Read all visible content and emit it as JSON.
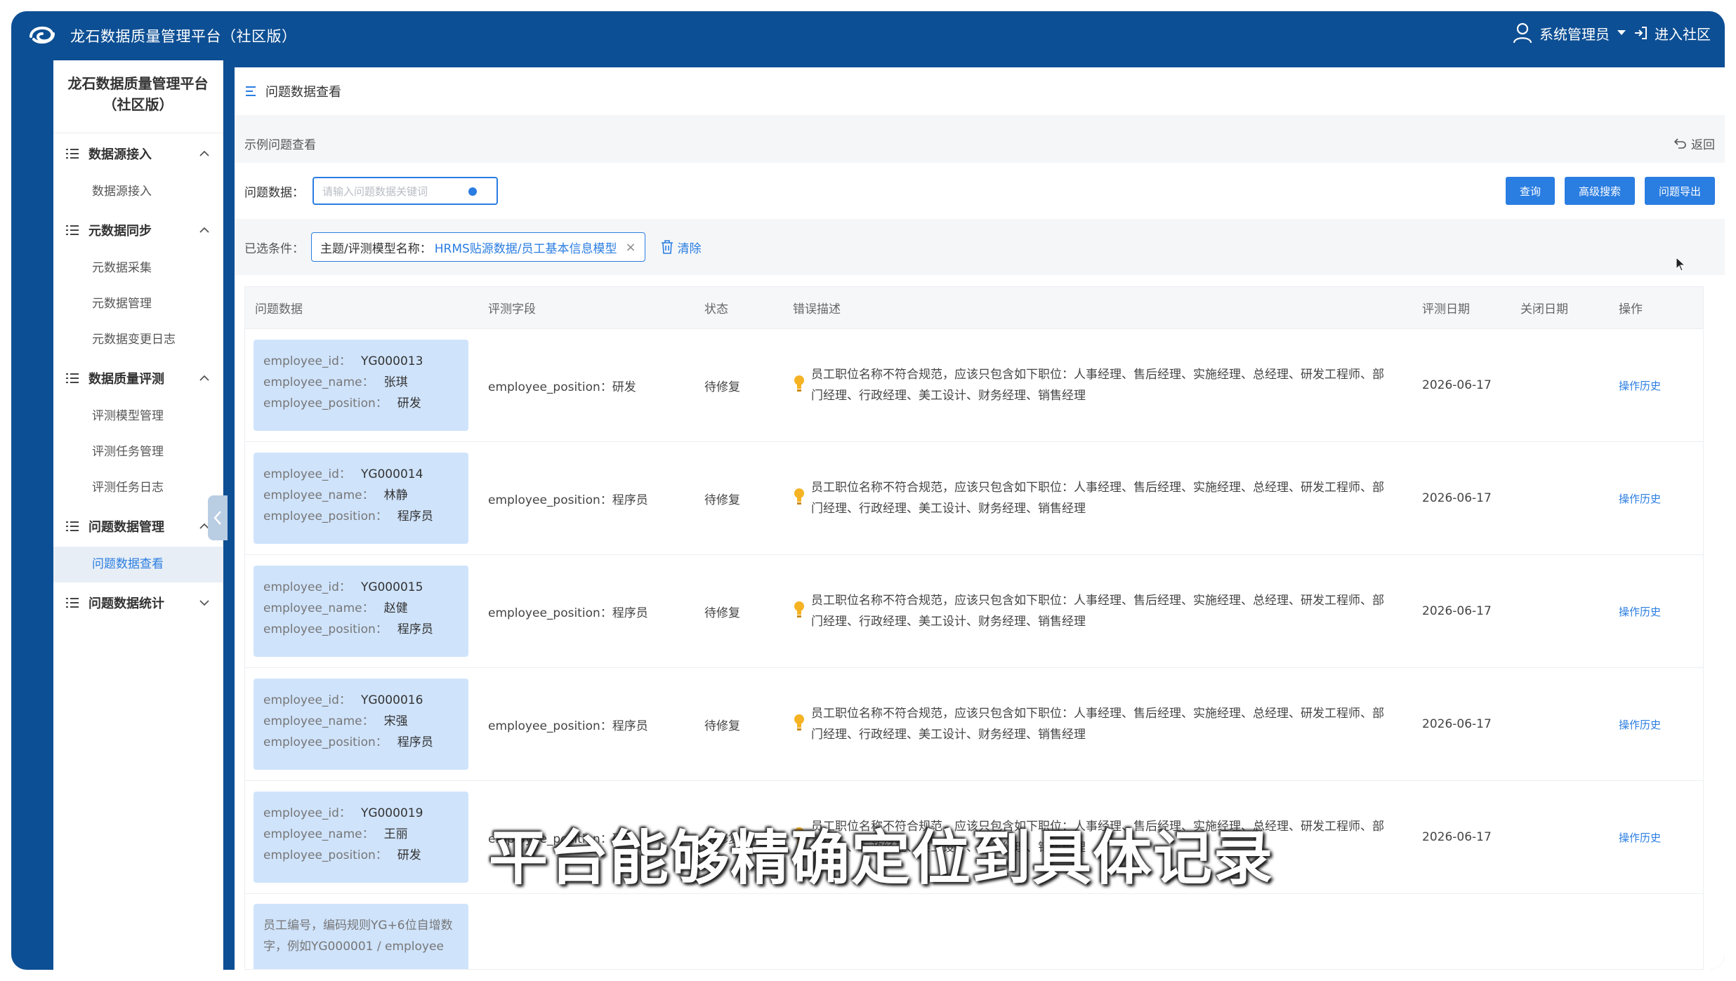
{
  "app": {
    "title": "龙石数据质量管理平台（社区版）",
    "user": "系统管理员",
    "enter_community": "进入社区"
  },
  "sidebar": {
    "title_line1": "龙石数据质量管理平台",
    "title_line2": "（社区版）",
    "groups": [
      {
        "label": "数据源接入",
        "expanded": true,
        "items": [
          "数据源接入"
        ]
      },
      {
        "label": "元数据同步",
        "expanded": true,
        "items": [
          "元数据采集",
          "元数据管理",
          "元数据变更日志"
        ]
      },
      {
        "label": "数据质量评测",
        "expanded": true,
        "items": [
          "评测模型管理",
          "评测任务管理",
          "评测任务日志"
        ]
      },
      {
        "label": "问题数据管理",
        "expanded": true,
        "items": [
          "问题数据查看"
        ]
      },
      {
        "label": "问题数据统计",
        "expanded": false,
        "items": []
      }
    ],
    "active_item": "问题数据查看"
  },
  "breadcrumb": "问题数据查看",
  "panel": {
    "title": "示例问题查看",
    "back_label": "返回"
  },
  "search": {
    "label": "问题数据：",
    "placeholder": "请输入问题数据关键词",
    "buttons": [
      "查询",
      "高级搜索",
      "问题导出"
    ]
  },
  "filter": {
    "label": "已选条件：",
    "tag_key": "主题/评测模型名称：",
    "tag_value": "HRMS贴源数据/员工基本信息模型",
    "clear_label": "清除"
  },
  "table": {
    "columns": [
      "问题数据",
      "评测字段",
      "状态",
      "错误描述",
      "评测日期",
      "关闭日期",
      "操作"
    ],
    "rows": [
      {
        "id_key": "employee_id：",
        "id": "YG000013",
        "name_key": "employee_name：",
        "name": "张琪",
        "pos_key": "employee_position：",
        "pos": "研发",
        "field": "employee_position：研发",
        "status": "待修复",
        "error": "员工职位名称不符合规范，应该只包含如下职位：人事经理、售后经理、实施经理、总经理、研发工程师、部门经理、行政经理、美工设计、财务经理、销售经理",
        "date": "2026-06-17",
        "close_date": "",
        "action": "操作历史"
      },
      {
        "id_key": "employee_id：",
        "id": "YG000014",
        "name_key": "employee_name：",
        "name": "林静",
        "pos_key": "employee_position：",
        "pos": "程序员",
        "field": "employee_position：程序员",
        "status": "待修复",
        "error": "员工职位名称不符合规范，应该只包含如下职位：人事经理、售后经理、实施经理、总经理、研发工程师、部门经理、行政经理、美工设计、财务经理、销售经理",
        "date": "2026-06-17",
        "close_date": "",
        "action": "操作历史"
      },
      {
        "id_key": "employee_id：",
        "id": "YG000015",
        "name_key": "employee_name：",
        "name": "赵健",
        "pos_key": "employee_position：",
        "pos": "程序员",
        "field": "employee_position：程序员",
        "status": "待修复",
        "error": "员工职位名称不符合规范，应该只包含如下职位：人事经理、售后经理、实施经理、总经理、研发工程师、部门经理、行政经理、美工设计、财务经理、销售经理",
        "date": "2026-06-17",
        "close_date": "",
        "action": "操作历史"
      },
      {
        "id_key": "employee_id：",
        "id": "YG000016",
        "name_key": "employee_name：",
        "name": "宋强",
        "pos_key": "employee_position：",
        "pos": "程序员",
        "field": "employee_position：程序员",
        "status": "待修复",
        "error": "员工职位名称不符合规范，应该只包含如下职位：人事经理、售后经理、实施经理、总经理、研发工程师、部门经理、行政经理、美工设计、财务经理、销售经理",
        "date": "2026-06-17",
        "close_date": "",
        "action": "操作历史"
      },
      {
        "id_key": "employee_id：",
        "id": "YG000019",
        "name_key": "employee_name：",
        "name": "王丽",
        "pos_key": "employee_position：",
        "pos": "研发",
        "field": "employee_position：研发",
        "status": "待修复",
        "error": "员工职位名称不符合规范，应该只包含如下职位：人事经理、售后经理、实施经理、总经理、研发工程师、部门经理、行政经理、美工设计、财务经理、销售经理",
        "date": "2026-06-17",
        "close_date": "",
        "action": "操作历史"
      }
    ],
    "partial_row_text": "员工编号，编码规则YG+6位自增数字，例如YG000001 / employee"
  },
  "subtitle": "平台能够精确定位到具体记录"
}
